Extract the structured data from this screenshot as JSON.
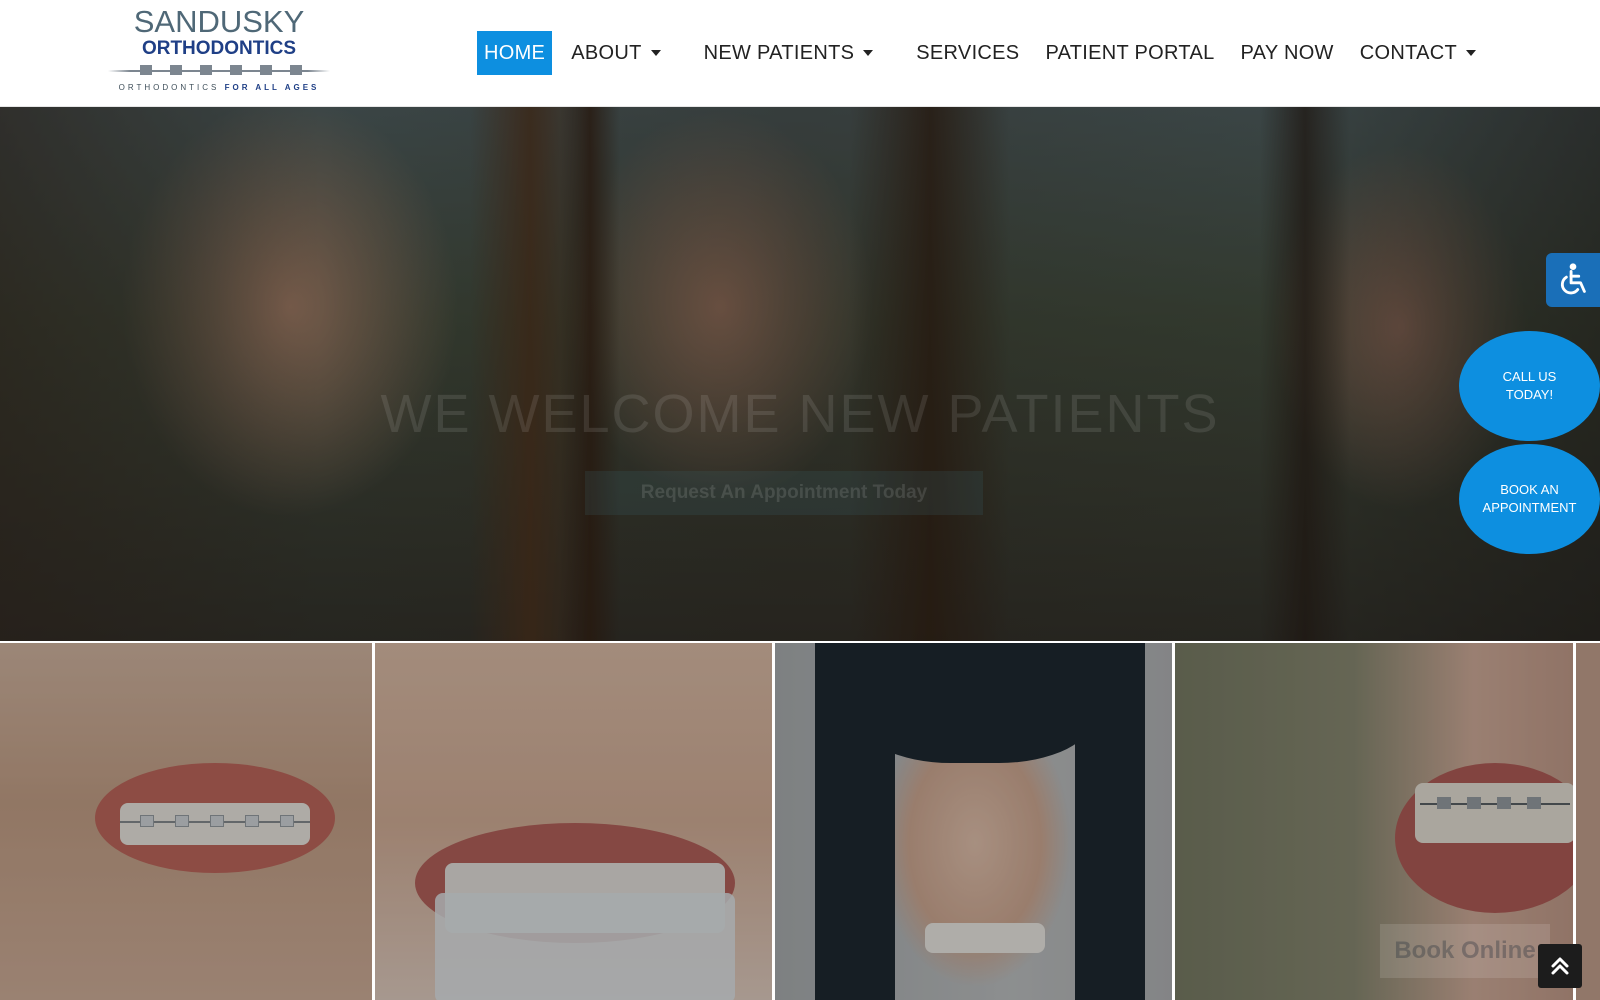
{
  "logo": {
    "title": "SANDUSKY",
    "subtitle": "ORTHODONTICS",
    "tagline_prefix": "ORTHODONTICS",
    "tagline_suffix": "FOR ALL AGES"
  },
  "nav": {
    "items": [
      {
        "label": "HOME",
        "active": true,
        "dropdown": false
      },
      {
        "label": "ABOUT",
        "active": false,
        "dropdown": true
      },
      {
        "label": "NEW PATIENTS",
        "active": false,
        "dropdown": true
      },
      {
        "label": "SERVICES",
        "active": false,
        "dropdown": false
      },
      {
        "label": "PATIENT PORTAL",
        "active": false,
        "dropdown": false
      },
      {
        "label": "PAY NOW",
        "active": false,
        "dropdown": false
      },
      {
        "label": "CONTACT",
        "active": false,
        "dropdown": true
      }
    ]
  },
  "hero": {
    "headline": "WE WELCOME NEW PATIENTS",
    "cta_label": "Request An Appointment Today"
  },
  "widgets": {
    "accessibility_icon": "wheelchair-icon",
    "call_line1": "CALL US",
    "call_line2": "TODAY!",
    "book_line1": "BOOK AN",
    "book_line2": "APPOINTMENT",
    "book_online": "Book Online",
    "scroll_top_icon": "double-chevron-up-icon"
  },
  "colors": {
    "accent": "#0d8fe0",
    "brand_navy": "#1f3f86",
    "brand_slate": "#4f6877",
    "accessibility_blue": "#1a6fb8"
  }
}
